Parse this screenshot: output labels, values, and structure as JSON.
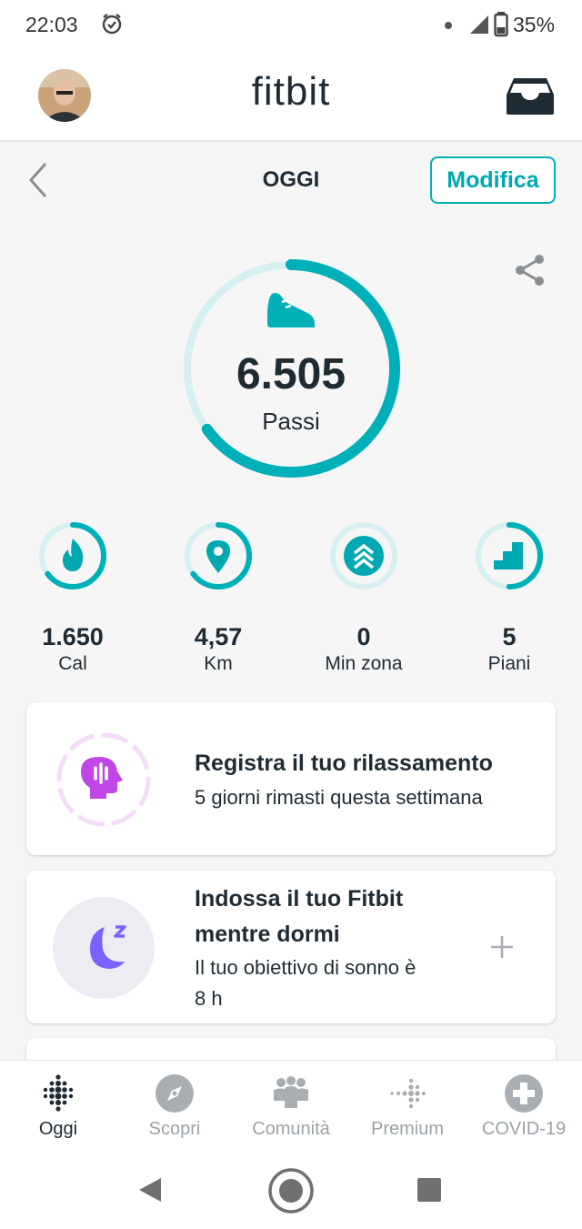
{
  "status": {
    "time": "22:03",
    "battery": "35%"
  },
  "header": {
    "brand": "fitbit"
  },
  "date": {
    "title": "OGGI",
    "edit_label": "Modifica"
  },
  "steps": {
    "value": "6.505",
    "label": "Passi",
    "progress": 0.65
  },
  "stats": [
    {
      "value": "1.650",
      "label": "Cal",
      "icon": "flame-icon",
      "progress": 0.65
    },
    {
      "value": "4,57",
      "label": "Km",
      "icon": "location-pin-icon",
      "progress": 0.65
    },
    {
      "value": "0",
      "label": "Min zona",
      "icon": "chevron-up-icon",
      "progress": 0.0
    },
    {
      "value": "5",
      "label": "Piani",
      "icon": "stairs-icon",
      "progress": 0.5
    }
  ],
  "cards": [
    {
      "title": "Registra il tuo rilassamento",
      "subtitle": "5 giorni rimasti questa settimana"
    },
    {
      "title_line1": "Indossa il tuo Fitbit",
      "title_line2": "mentre dormi",
      "subtitle_line1": "Il tuo obiettivo di sonno è",
      "subtitle_line2": "8 h"
    }
  ],
  "nav": [
    {
      "label": "Oggi",
      "active": true
    },
    {
      "label": "Scopri"
    },
    {
      "label": "Comunità"
    },
    {
      "label": "Premium"
    },
    {
      "label": "COVID-19"
    }
  ],
  "colors": {
    "accent": "#00b0b9",
    "ring_track": "#d6eff1",
    "text": "#1f2b33",
    "relax_purple": "#c146e8",
    "sleep_purple": "#7b61ff"
  }
}
